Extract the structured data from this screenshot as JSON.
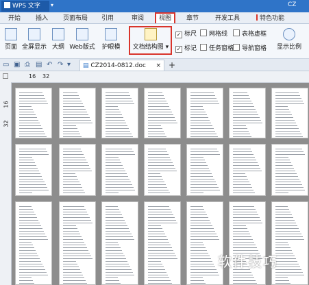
{
  "app": {
    "name": "WPS 文字",
    "title_right": "CZ"
  },
  "menu_tabs": [
    "开始",
    "插入",
    "页面布局",
    "引用",
    "审阅",
    "视图",
    "章节",
    "开发工具",
    "特色功能"
  ],
  "active_tab": "视图",
  "ribbon": {
    "buttons": [
      "页面",
      "全屏显示",
      "大纲",
      "Web版式",
      "护眼模",
      "文档结构图",
      "显示比例"
    ],
    "checkboxes": [
      {
        "label": "标尺",
        "checked": true
      },
      {
        "label": "网格线",
        "checked": false
      },
      {
        "label": "表格虚框",
        "checked": false
      },
      {
        "label": "标记",
        "checked": true
      },
      {
        "label": "任务窗格",
        "checked": false
      },
      {
        "label": "导航窗格",
        "checked": false
      }
    ]
  },
  "document_tab": {
    "name": "CZ2014-0812.doc",
    "close": "×"
  },
  "add_tab": "+",
  "ruler": {
    "top_ticks": [
      "16",
      "32"
    ],
    "left_ticks": [
      "16",
      "32"
    ]
  },
  "watermark": "软件技巧",
  "colors": {
    "titlebar": "#2f74c8",
    "highlight": "#d9342b"
  }
}
